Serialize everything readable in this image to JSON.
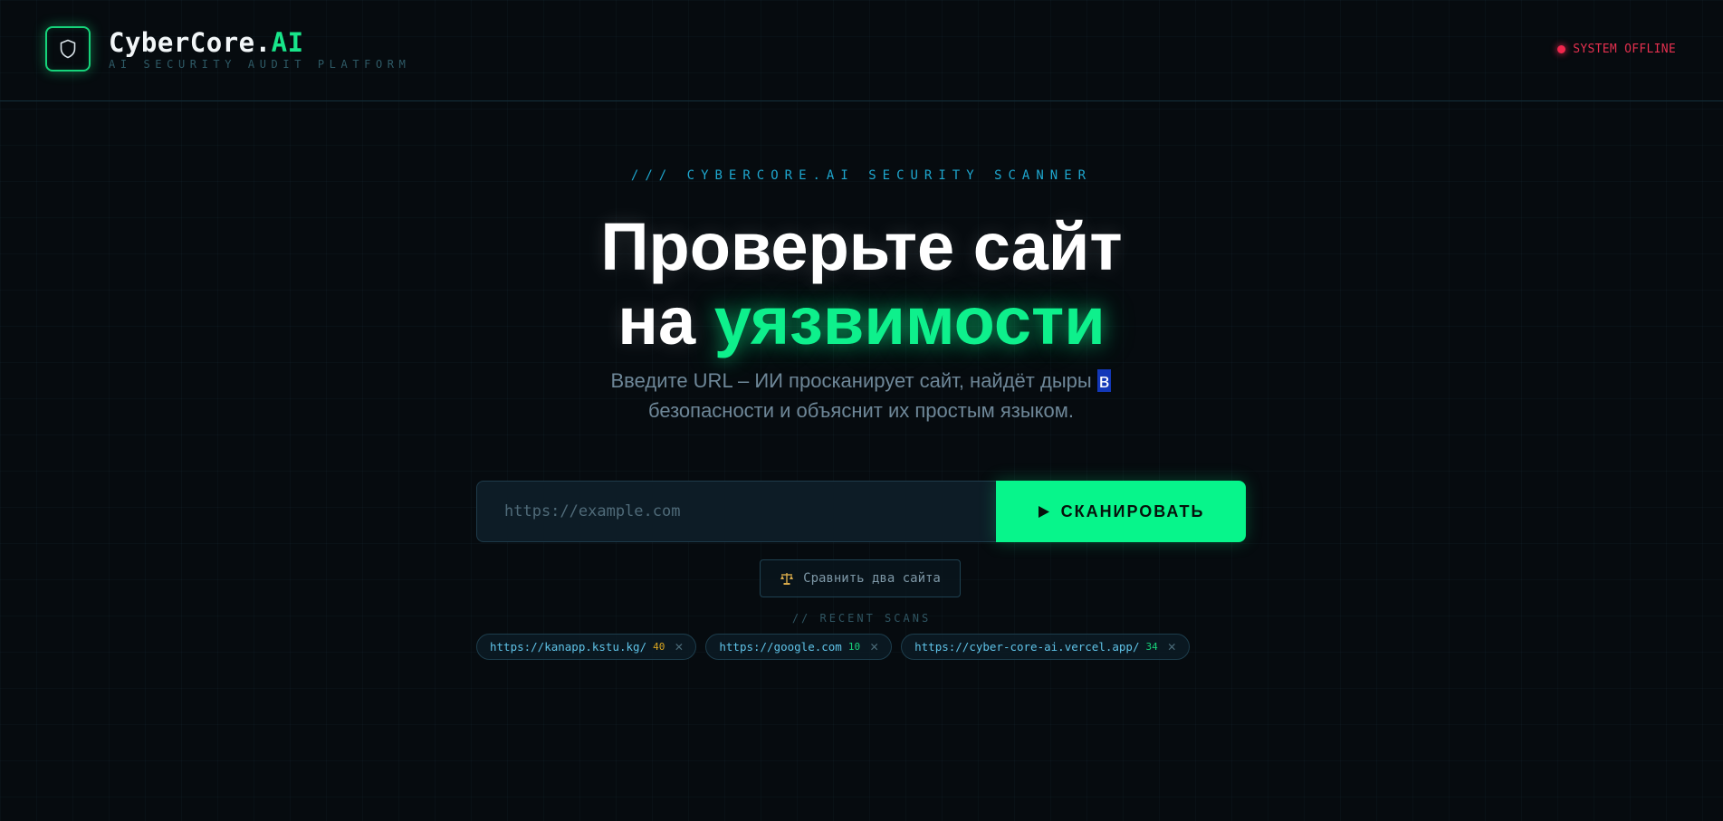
{
  "header": {
    "brand_main": "CyberCore.",
    "brand_accent": "AI",
    "brand_subtitle": "AI SECURITY AUDIT PLATFORM",
    "status_text": "SYSTEM OFFLINE",
    "logo_icon": "shield-icon"
  },
  "hero": {
    "kicker": "/// CYBERCORE.AI SECURITY SCANNER",
    "title_line1": "Проверьте сайт",
    "title_line2_prefix": "на ",
    "title_line2_accent": "уязвимости",
    "subtitle_part1": "Введите URL – ИИ просканирует сайт, найдёт дыры ",
    "subtitle_selected": "в",
    "subtitle_part2": " безопасности и объяснит их простым языком."
  },
  "scan": {
    "placeholder": "https://example.com",
    "button_label": "СКАНИРОВАТЬ",
    "button_icon": "play-icon"
  },
  "compare": {
    "icon": "scales-icon",
    "label": "Сравнить два сайта"
  },
  "recent": {
    "title": "// RECENT SCANS",
    "items": [
      {
        "url": "https://kanapp.kstu.kg/",
        "score": "40",
        "score_color": "#d9a520"
      },
      {
        "url": "https://google.com",
        "score": "10",
        "score_color": "#18d27a"
      },
      {
        "url": "https://cyber-core-ai.vercel.app/",
        "score": "34",
        "score_color": "#18d27a"
      }
    ]
  },
  "colors": {
    "accent": "#07f58b",
    "background": "#060b0f",
    "status_red": "#f0274d",
    "cyan": "#1ea7cf"
  }
}
